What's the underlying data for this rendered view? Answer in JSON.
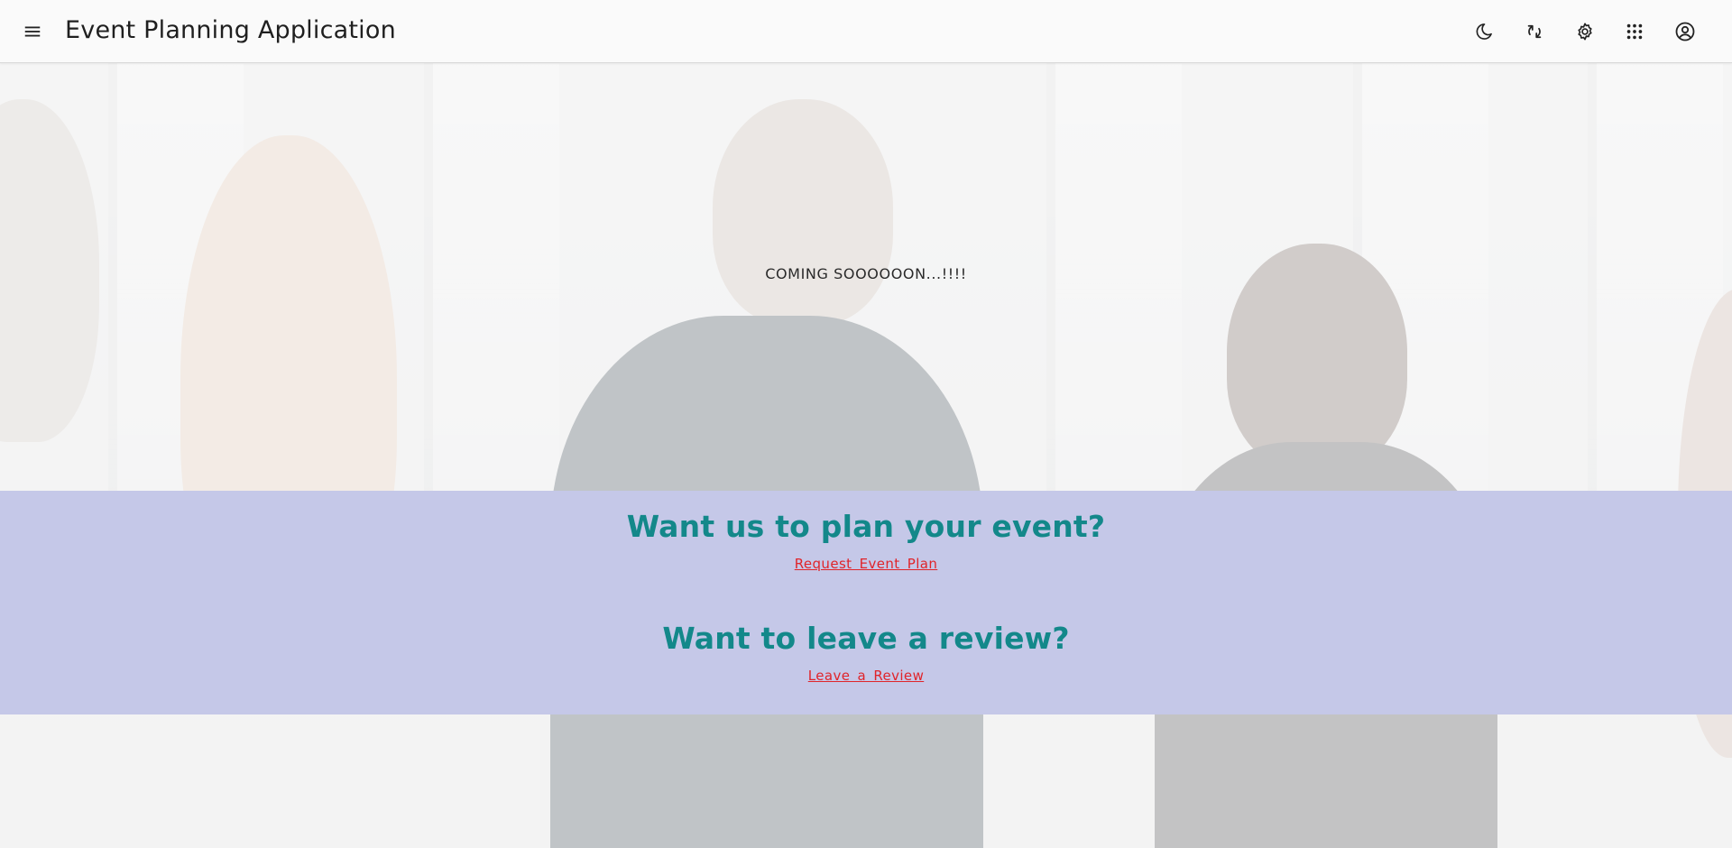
{
  "header": {
    "title": "Event Planning Application",
    "icons": [
      "menu-icon",
      "dark-mode-icon",
      "refresh-icon",
      "settings-icon",
      "apps-grid-icon",
      "account-circle-icon"
    ]
  },
  "hero": {
    "message": "COMING SOOOOOON...!!!!"
  },
  "cta": {
    "plan_heading": "Want us to plan your event?",
    "plan_link": "Request Event Plan",
    "review_heading": "Want to leave a review?",
    "review_link": "Leave a Review"
  },
  "colors": {
    "accent_heading": "#13888a",
    "link": "#e0242a",
    "cta_band": "#c5c8e8",
    "topbar": "#fafafa"
  }
}
